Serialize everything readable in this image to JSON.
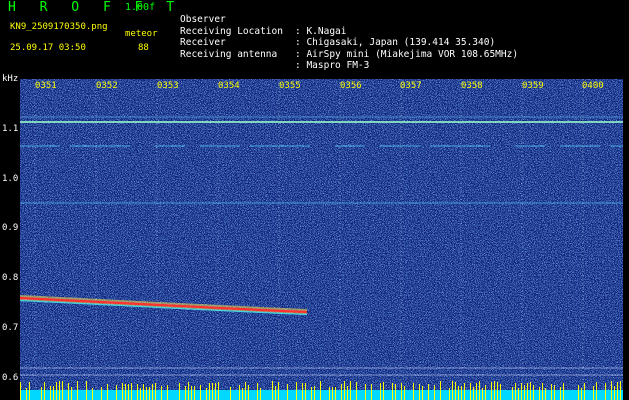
{
  "header": {
    "app_title": "H R O F F T",
    "version": "1.00f",
    "filename": "KN9_2509170350.png",
    "mode": "meteor",
    "datetime": "25.09.17 03:50",
    "count": "88"
  },
  "info": [
    {
      "label": "Observer",
      "value": ": K.Nagai"
    },
    {
      "label": "Receiving Location",
      "value": ": Chigasaki, Japan (139.414 35.340)"
    },
    {
      "label": "Receiver",
      "value": ": AirSpy mini (Miakejima VOR 108.65MHz)"
    },
    {
      "label": "Receiving antenna",
      "value": ": Maspro FM-3"
    }
  ],
  "y_axis": {
    "unit": "kHz",
    "ticks": [
      "1.1",
      "1.0",
      "0.9",
      "0.8",
      "0.7",
      "0.6"
    ]
  },
  "x_axis": {
    "ticks": [
      "0351",
      "0352",
      "0353",
      "0354",
      "0355",
      "0356",
      "0357",
      "0358",
      "0359",
      "0400"
    ]
  },
  "colors": {
    "background": "#000000",
    "spectrogram_base": "#0a1e78",
    "title_green": "#00ff00",
    "label_yellow": "#ffff00",
    "text_white": "#ffffff",
    "meteor_trace": "#ff3030",
    "bottom_bar": "#00d8ff"
  }
}
